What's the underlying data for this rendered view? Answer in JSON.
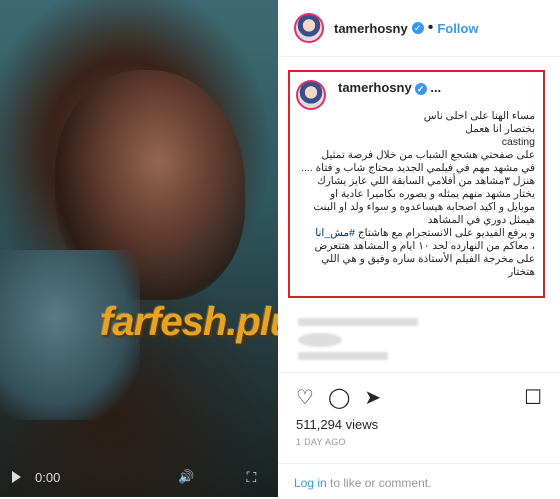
{
  "video": {
    "time": "0:00",
    "watermark": "farfesh.plus.com"
  },
  "header": {
    "username": "tamerhosny",
    "separator": "•",
    "follow_label": "Follow"
  },
  "post": {
    "username": "tamerhosny",
    "ellipsis": "...",
    "caption_lines": [
      "مساء الهنا على احلى ناس",
      "بختصار انا هعمل",
      "casting",
      "على صفحتي هشجع الشباب من خلال فرصة تمثيل",
      "في مشهد مهم في فيلمي الجديد محتاج شاب و فتاة ....",
      "هنزل ٣مشاهد من أفلامي السابقة اللي عايز يشارك",
      "يختار مشهد منهم يمثله و يصوره بكاميرا عادية او",
      "موبايل و اكيد اصحابه هيساعدوه و سواء ولد او البنت",
      "هيمثل دوري في المشاهد"
    ],
    "hashtag_line_prefix": "و يرفع الفيديو على الانستجرام مع هاشتاج ",
    "hashtag": "#مش_انا",
    "caption_lines_after": [
      "، معاكم من النهارده لحد ١٠ ايام و المشاهد هتتعرض",
      "على مخرجة الفيلم الأستاذة ساره وفيق و هي اللي",
      "هتختار"
    ]
  },
  "actions": {
    "views": "511,294 views",
    "date": "1 DAY AGO",
    "comment_link": "Log in",
    "comment_text": " to like or comment."
  },
  "colors": {
    "accent": "#3897f0",
    "highlight_box": "#d9252a"
  }
}
